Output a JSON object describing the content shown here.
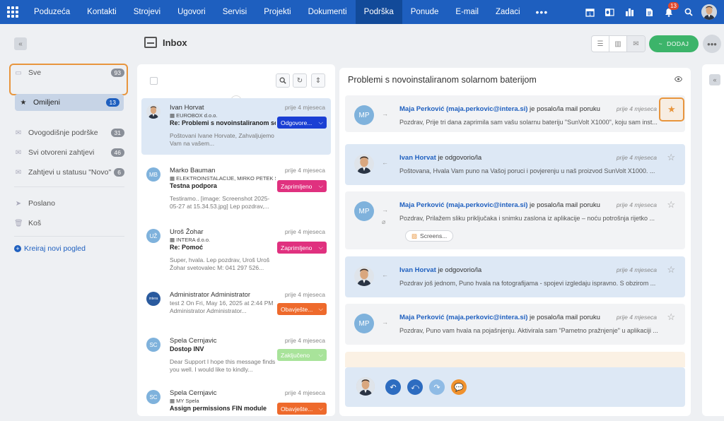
{
  "nav": {
    "items": [
      "Poduzeća",
      "Kontakti",
      "Strojevi",
      "Ugovori",
      "Servisi",
      "Projekti",
      "Dokumenti",
      "Podrška",
      "Ponude",
      "E-mail",
      "Zadaci"
    ],
    "active": "Podrška",
    "more": "•••",
    "notification_count": "13"
  },
  "sidebar": {
    "items": [
      {
        "label": "Sve",
        "count": "93",
        "icon": "inbox-icon"
      },
      {
        "label": "Omiljeni",
        "count": "13",
        "icon": "star-icon"
      },
      {
        "label": "Ovogodišnje podrške",
        "count": "31",
        "icon": "envelope-icon"
      },
      {
        "label": "Svi otvoreni zahtjevi",
        "count": "46",
        "icon": "envelope-icon"
      },
      {
        "label": "Zahtjevi u statusu \"Novo\"",
        "count": "6",
        "icon": "envelope-icon"
      },
      {
        "label": "Poslano",
        "icon": "send-icon"
      },
      {
        "label": "Koš",
        "icon": "trash-icon"
      }
    ],
    "create_view": "Kreiraj novi pogled"
  },
  "header": {
    "title": "Inbox",
    "add_label": "DODAJ"
  },
  "messages": [
    {
      "name": "Ivan Horvat",
      "company": "EUROBOX d.o.o.",
      "subject": "Re: Problemi s novoinstaliranom so...",
      "preview": "Poštovani Ivane Horvate, Zahvaljujemo Vam na vašem...",
      "time": "prije 4 mjeseca",
      "tag": "Odgovore...",
      "tag_color": "#1a3fd4",
      "avatar": "photo"
    },
    {
      "name": "Marko Bauman",
      "company": "ELEKTROINSTALACIJE, MIRKO PETEK S...",
      "subject": "Testna podpora",
      "preview": "Testiramo.. [image: Screenshot 2025-05-27 at 15.34.53.jpg] Lep pozdrav,...",
      "time": "prije 4 mjeseca",
      "tag": "Zaprimljeno",
      "tag_color": "#e0317f",
      "avatar": "MB",
      "avatar_color": "#7fb2dc"
    },
    {
      "name": "Uroš Žohar",
      "company": "INTERA d.o.o.",
      "subject": "Re: Pomoć",
      "preview": "Super, hvala. Lep pozdrav, Uroš Uroš Žohar svetovalec M: 041 297 526...",
      "time": "prije 4 mjeseca",
      "tag": "Zaprimljeno",
      "tag_color": "#e0317f",
      "avatar": "UŽ",
      "avatar_color": "#7fb2dc"
    },
    {
      "name": "Administrator Administrator",
      "company": "",
      "subject": "",
      "preview": "test 2   On Fri, May 16, 2025 at 2:44 PM Administrator Administrator...",
      "time": "prije 4 mjeseca",
      "tag": "Obavješte...",
      "tag_color": "#ee6a2c",
      "avatar": "intera",
      "avatar_color": "#2a5a9e"
    },
    {
      "name": "Spela Cernjavic",
      "company": "",
      "subject": "Dostop INV",
      "preview": "Dear Support I hope this message finds you well. I would like to kindly...",
      "time": "prije 4 mjeseca",
      "tag": "Zaključeno",
      "tag_color": "#a8e39a",
      "avatar": "SC",
      "avatar_color": "#7fb2dc"
    },
    {
      "name": "Spela Cernjavic",
      "company": "MY Spela",
      "subject": "Assign permissions FIN module",
      "preview": "",
      "time": "prije 4 mjeseca",
      "tag": "Obavješte...",
      "tag_color": "#ee6a2c",
      "avatar": "SC",
      "avatar_color": "#7fb2dc"
    }
  ],
  "detail": {
    "title": "Problemi s novoinstaliranom solarnom baterijom",
    "posts": [
      {
        "who": "Maja Perković (maja.perkovic@intera.si)",
        "action": " je posalo/la mail poruku",
        "time": "prije 4 mjeseca",
        "text": "Pozdrav, Prije tri dana zaprimila sam vašu solarnu bateriju \"SunVolt X1000\", koju sam inst...",
        "avatar": "MP",
        "dir": "out",
        "starred": true
      },
      {
        "who": "Ivan Horvat",
        "action": " je odgovorio/la",
        "time": "prije 4 mjeseca",
        "text": "Poštovana, Hvala Vam puno na Vašoj poruci i povjerenju u naš proizvod SunVolt X1000. ...",
        "avatar": "photo",
        "dir": "in"
      },
      {
        "who": "Maja Perković (maja.perkovic@intera.si)",
        "action": " je posalo/la mail poruku",
        "time": "prije 4 mjeseca",
        "text": "Pozdrav, Prilažem sliku priključaka i snimku zaslona iz aplikacije – noću potrošnja rijetko ...",
        "avatar": "MP",
        "dir": "out",
        "attachment": "Screens..."
      },
      {
        "who": "Ivan Horvat",
        "action": " je odgovorio/la",
        "time": "prije 4 mjeseca",
        "text": "Pozdrav još jednom, Puno hvala na fotografijama - spojevi izgledaju ispravno. S obzirom ...",
        "avatar": "photo",
        "dir": "in"
      },
      {
        "who": "Maja Perković (maja.perkovic@intera.si)",
        "action": " je posalo/la mail poruku",
        "time": "prije 4 mjeseca",
        "text": "Pozdrav, Puno vam hvala na pojašnjenju. Aktivirala sam \"Pametno pražnjenje\" u aplikaciji ...",
        "avatar": "MP",
        "dir": "out"
      }
    ]
  },
  "colors": {
    "brand": "#1e5fbf",
    "accent": "#e8953d",
    "add_green": "#3cb46a"
  }
}
